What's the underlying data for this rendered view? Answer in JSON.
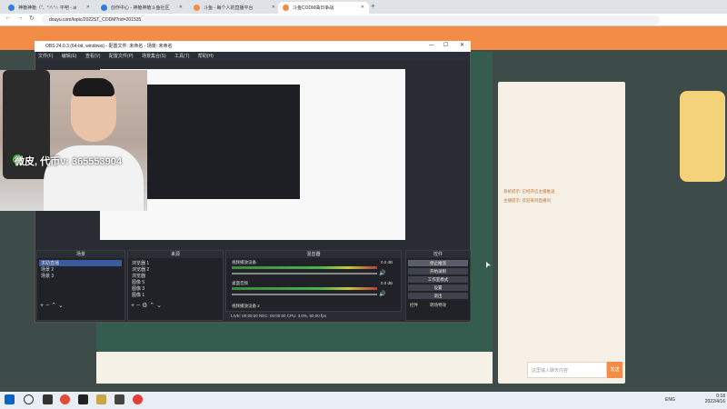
{
  "browser": {
    "tabs": [
      {
        "label": "神槍神槍（\"、°∧°∩ 平吧 - ai"
      },
      {
        "label": "创作中心 - 神槍神槍斗鱼社区"
      },
      {
        "label": "斗鱼 - 每个人的直播平台"
      },
      {
        "label": "斗鱼CODM曲日争战"
      }
    ],
    "url": "douyu.com/topic/2022ST_CODM?rid=201535"
  },
  "obs": {
    "title": "OBS 24.0.3 (64-bit, windows) - 配置文件: 未命名 - 场景: 未命名",
    "menu": [
      "文件(F)",
      "编辑(E)",
      "查看(V)",
      "配置文件(P)",
      "场景集合(S)",
      "工具(T)",
      "帮助(H)"
    ],
    "scenes_title": "场景",
    "scenes": [
      "求助直播",
      "场景 2",
      "场景 3"
    ],
    "sources_title": "来源",
    "sources": [
      "浏览器 1",
      "浏览器 2",
      "浏览器",
      "图像 5",
      "图像 3",
      "图像 1"
    ],
    "mixer_title": "混音器",
    "mixer": [
      {
        "label": "视频播放设备",
        "db": "0.0 dB"
      },
      {
        "label": "桌面音频",
        "db": "0.0 dB"
      },
      {
        "label": "视频播放设备 2",
        "db": ""
      }
    ],
    "controls_title": "控件",
    "controls": [
      "停止推流",
      "开始录制",
      "工作室模式",
      "设置",
      "退出"
    ],
    "control_tabs": [
      "控件",
      "转场特效"
    ],
    "status": "LIVE: 00:00:00   REC: 00:00:00   CPU: 3.0%, 60.00 fps"
  },
  "webcam": {
    "overlay_text": "微皮, 代币v: 365553904"
  },
  "chat": {
    "send_label": "发送",
    "input_placeholder": "这里输入聊天内容",
    "lines": [
      "系统提示: 已经开启主播推送",
      "主播提示: 欢迎来到直播间"
    ]
  },
  "taskbar": {
    "lang": "ENG",
    "time": "0:18",
    "date": "2022/4/16"
  },
  "colors": {
    "accent": "#f28c46",
    "obs_bg": "#2a2c33"
  }
}
